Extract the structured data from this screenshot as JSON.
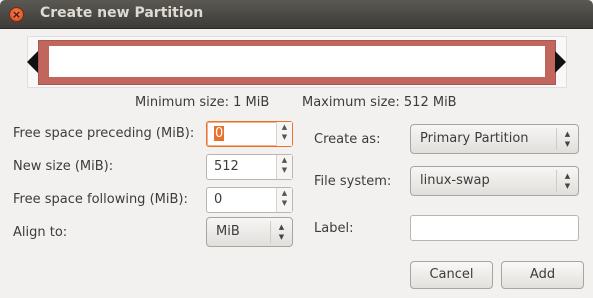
{
  "window": {
    "title": "Create new Partition",
    "close_glyph": "×"
  },
  "visualizer": {
    "partition_color": "#c0665d",
    "min_size_label": "Minimum size: 1 MiB",
    "max_size_label": "Maximum size: 512 MiB"
  },
  "left_form": {
    "free_preceding": {
      "label": "Free space preceding (MiB):",
      "value": "0"
    },
    "new_size": {
      "label": "New size (MiB):",
      "value": "512"
    },
    "free_following": {
      "label": "Free space following (MiB):",
      "value": "0"
    },
    "align_to": {
      "label": "Align to:",
      "value": "MiB"
    }
  },
  "right_form": {
    "create_as": {
      "label": "Create as:",
      "value": "Primary Partition"
    },
    "file_system": {
      "label": "File system:",
      "value": "linux-swap"
    },
    "partition_label": {
      "label": "Label:",
      "value": ""
    }
  },
  "buttons": {
    "cancel": "Cancel",
    "add": "Add"
  },
  "icons": {
    "spin_up": "▲",
    "spin_down": "▼"
  }
}
